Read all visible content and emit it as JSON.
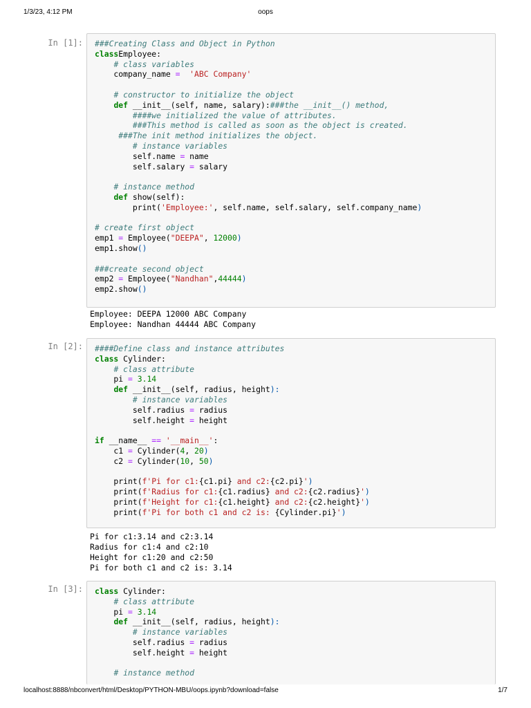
{
  "header": {
    "datetime": "1/3/23, 4:12 PM",
    "title": "oops"
  },
  "footer": {
    "url": "localhost:8888/nbconvert/html/Desktop/PYTHON-MBU/oops.ipynb?download=false",
    "page": "1/7"
  },
  "cells": [
    {
      "prompt": "In [1]:",
      "code": [
        [
          [
            "cm",
            "###Creating Class and Object in Python"
          ]
        ],
        [
          [
            "kw",
            "class"
          ],
          [
            "",
            "Employee:"
          ]
        ],
        [
          [
            "",
            "    "
          ],
          [
            "cm",
            "# class variables"
          ]
        ],
        [
          [
            "",
            "    company_name "
          ],
          [
            "op",
            "="
          ],
          [
            "",
            "  "
          ],
          [
            "st",
            "'ABC Company'"
          ]
        ],
        [
          [
            "",
            ""
          ]
        ],
        [
          [
            "",
            "    "
          ],
          [
            "cm",
            "# constructor to initialize the object"
          ]
        ],
        [
          [
            "",
            "    "
          ],
          [
            "kw",
            "def"
          ],
          [
            "",
            " __init__(self, name, salary):"
          ],
          [
            "cm",
            "###the __init__() method,"
          ]
        ],
        [
          [
            "",
            "        "
          ],
          [
            "cm",
            "####we initialized the value of attributes."
          ]
        ],
        [
          [
            "",
            "        "
          ],
          [
            "cm",
            "###This method is called as soon as the object is created."
          ]
        ],
        [
          [
            "",
            "     "
          ],
          [
            "cm",
            "###The init method initializes the object."
          ]
        ],
        [
          [
            "",
            "        "
          ],
          [
            "cm",
            "# instance variables"
          ]
        ],
        [
          [
            "",
            "        self.name "
          ],
          [
            "op",
            "="
          ],
          [
            "",
            " name"
          ]
        ],
        [
          [
            "",
            "        self.salary "
          ],
          [
            "op",
            "="
          ],
          [
            "",
            " salary"
          ]
        ],
        [
          [
            "",
            ""
          ]
        ],
        [
          [
            "",
            "    "
          ],
          [
            "cm",
            "# instance method"
          ]
        ],
        [
          [
            "",
            "    "
          ],
          [
            "kw",
            "def"
          ],
          [
            "",
            " show(self):"
          ]
        ],
        [
          [
            "",
            "        print("
          ],
          [
            "st",
            "'Employee:'"
          ],
          [
            "",
            ", self.name, self.salary, self.company_name"
          ],
          [
            "pu",
            ")"
          ]
        ],
        [
          [
            "",
            ""
          ]
        ],
        [
          [
            "cm",
            "# create first object"
          ]
        ],
        [
          [
            "",
            "emp1 "
          ],
          [
            "op",
            "="
          ],
          [
            "",
            " Employee("
          ],
          [
            "st",
            "\"DEEPA\""
          ],
          [
            "",
            ", "
          ],
          [
            "nm",
            "12000"
          ],
          [
            "pu",
            ")"
          ]
        ],
        [
          [
            "",
            "emp1.show"
          ],
          [
            "pu",
            "()"
          ]
        ],
        [
          [
            "",
            ""
          ]
        ],
        [
          [
            "cm",
            "###create second object"
          ]
        ],
        [
          [
            "",
            "emp2 "
          ],
          [
            "op",
            "="
          ],
          [
            "",
            " Employee("
          ],
          [
            "st",
            "\"Nandhan\""
          ],
          [
            "",
            ","
          ],
          [
            "nm",
            "44444"
          ],
          [
            "pu",
            ")"
          ]
        ],
        [
          [
            "",
            "emp2.show"
          ],
          [
            "pu",
            "()"
          ]
        ]
      ],
      "output": [
        "Employee: DEEPA 12000 ABC Company",
        "Employee: Nandhan 44444 ABC Company"
      ]
    },
    {
      "prompt": "In [2]:",
      "code": [
        [
          [
            "cm",
            "####Define class and instance attributes"
          ]
        ],
        [
          [
            "kw",
            "class"
          ],
          [
            "",
            " Cylinder:"
          ]
        ],
        [
          [
            "",
            "    "
          ],
          [
            "cm",
            "# class attribute"
          ]
        ],
        [
          [
            "",
            "    pi "
          ],
          [
            "op",
            "="
          ],
          [
            "",
            " "
          ],
          [
            "nm",
            "3.14"
          ]
        ],
        [
          [
            "",
            "    "
          ],
          [
            "kw",
            "def"
          ],
          [
            "",
            " __init__(self, radius, height"
          ],
          [
            "pu",
            "):"
          ]
        ],
        [
          [
            "",
            "        "
          ],
          [
            "cm",
            "# instance variables"
          ]
        ],
        [
          [
            "",
            "        self.radius "
          ],
          [
            "op",
            "="
          ],
          [
            "",
            " radius"
          ]
        ],
        [
          [
            "",
            "        self.height "
          ],
          [
            "op",
            "="
          ],
          [
            "",
            " height"
          ]
        ],
        [
          [
            "",
            ""
          ]
        ],
        [
          [
            "kw",
            "if"
          ],
          [
            "",
            " __name__ "
          ],
          [
            "op",
            "=="
          ],
          [
            "",
            " "
          ],
          [
            "st",
            "'__main__'"
          ],
          [
            "",
            ":"
          ]
        ],
        [
          [
            "",
            "    c1 "
          ],
          [
            "op",
            "="
          ],
          [
            "",
            " Cylinder("
          ],
          [
            "nm",
            "4"
          ],
          [
            "",
            ", "
          ],
          [
            "nm",
            "20"
          ],
          [
            "pu",
            ")"
          ]
        ],
        [
          [
            "",
            "    c2 "
          ],
          [
            "op",
            "="
          ],
          [
            "",
            " Cylinder("
          ],
          [
            "nm",
            "10"
          ],
          [
            "",
            ", "
          ],
          [
            "nm",
            "50"
          ],
          [
            "pu",
            ")"
          ]
        ],
        [
          [
            "",
            ""
          ]
        ],
        [
          [
            "",
            "    print("
          ],
          [
            "st",
            "f'Pi for c1:"
          ],
          [
            "",
            "{c1.pi}"
          ],
          [
            "st",
            " and c2:"
          ],
          [
            "",
            "{c2.pi}"
          ],
          [
            "st",
            "'"
          ],
          [
            "pu",
            ")"
          ]
        ],
        [
          [
            "",
            "    print("
          ],
          [
            "st",
            "f'Radius for c1:"
          ],
          [
            "",
            "{c1.radius}"
          ],
          [
            "st",
            " and c2:"
          ],
          [
            "",
            "{c2.radius}"
          ],
          [
            "st",
            "'"
          ],
          [
            "pu",
            ")"
          ]
        ],
        [
          [
            "",
            "    print("
          ],
          [
            "st",
            "f'Height for c1:"
          ],
          [
            "",
            "{c1.height}"
          ],
          [
            "st",
            " and c2:"
          ],
          [
            "",
            "{c2.height}"
          ],
          [
            "st",
            "'"
          ],
          [
            "pu",
            ")"
          ]
        ],
        [
          [
            "",
            "    print("
          ],
          [
            "st",
            "f'Pi for both c1 and c2 is: "
          ],
          [
            "",
            "{Cylinder.pi}"
          ],
          [
            "st",
            "'"
          ],
          [
            "pu",
            ")"
          ]
        ]
      ],
      "output": [
        "Pi for c1:3.14 and c2:3.14",
        "Radius for c1:4 and c2:10",
        "Height for c1:20 and c2:50",
        "Pi for both c1 and c2 is: 3.14"
      ]
    },
    {
      "prompt": "In [3]:",
      "code": [
        [
          [
            "kw",
            "class"
          ],
          [
            "",
            " Cylinder:"
          ]
        ],
        [
          [
            "",
            "    "
          ],
          [
            "cm",
            "# class attribute"
          ]
        ],
        [
          [
            "",
            "    pi "
          ],
          [
            "op",
            "="
          ],
          [
            "",
            " "
          ],
          [
            "nm",
            "3.14"
          ]
        ],
        [
          [
            "",
            "    "
          ],
          [
            "kw",
            "def"
          ],
          [
            "",
            " __init__(self, radius, height"
          ],
          [
            "pu",
            "):"
          ]
        ],
        [
          [
            "",
            "        "
          ],
          [
            "cm",
            "# instance variables"
          ]
        ],
        [
          [
            "",
            "        self.radius "
          ],
          [
            "op",
            "="
          ],
          [
            "",
            " radius"
          ]
        ],
        [
          [
            "",
            "        self.height "
          ],
          [
            "op",
            "="
          ],
          [
            "",
            " height"
          ]
        ],
        [
          [
            "",
            ""
          ]
        ],
        [
          [
            "",
            "    "
          ],
          [
            "cm",
            "# instance method"
          ]
        ]
      ],
      "output": []
    }
  ]
}
